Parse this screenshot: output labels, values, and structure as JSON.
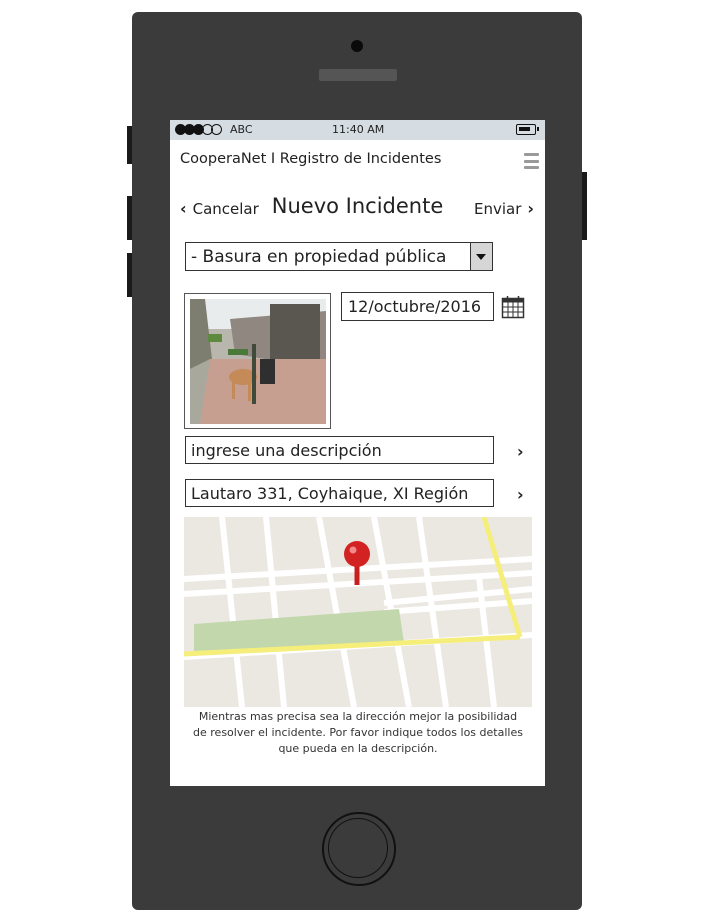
{
  "status_bar": {
    "carrier": "ABC",
    "time": "11:40 AM"
  },
  "header": {
    "app_title": "CooperaNet I Registro de Incidentes",
    "menu_icon": "hamburger-menu-icon"
  },
  "nav": {
    "cancel_label": "Cancelar",
    "title": "Nuevo Incidente",
    "send_label": "Enviar"
  },
  "form": {
    "category_selected": "- Basura en propiedad pública",
    "date_value": "12/octubre/2016",
    "description_placeholder": "ingrese una descripción",
    "address_value": "Lautaro 331, Coyhaique, XI Región",
    "hint_line1": "Mientras mas precisa sea la dirección mejor la posibilidad",
    "hint_line2": "de resolver el incidente. Por favor indique todos los detalles",
    "hint_line3": "que pueda en la descripción."
  },
  "colors": {
    "phone_body": "#3b3b3b",
    "status_bar": "#d6dde2",
    "map_road_yellow": "#f5ee7a",
    "map_park": "#c2d8ac",
    "map_pin": "#d32222"
  }
}
